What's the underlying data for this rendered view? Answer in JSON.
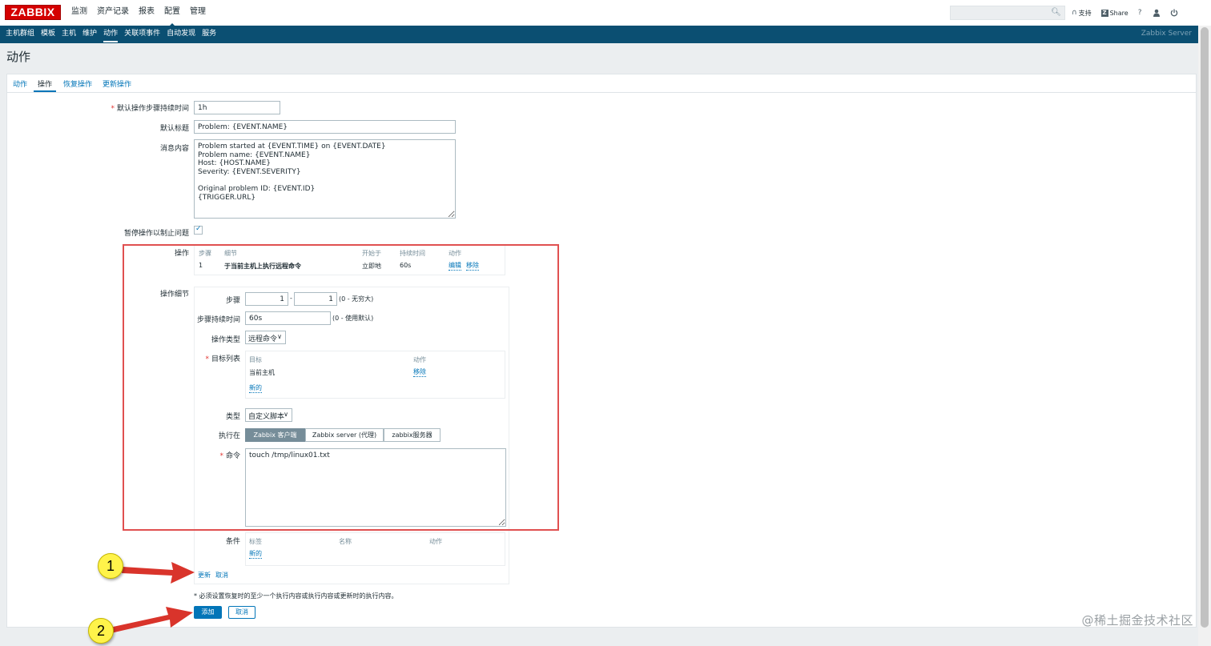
{
  "header": {
    "logo": "ZABBIX",
    "menu": [
      "监测",
      "资产记录",
      "报表",
      "配置",
      "管理"
    ],
    "support": "支持",
    "share": "Share",
    "help": "?",
    "icons": [
      "search-icon",
      "headset-icon",
      "help-icon",
      "user-icon",
      "power-icon"
    ]
  },
  "subnav": {
    "items": [
      "主机群组",
      "模板",
      "主机",
      "维护",
      "动作",
      "关联项事件",
      "自动发现",
      "服务"
    ],
    "server_name": "Zabbix Server"
  },
  "page": {
    "title": "动作"
  },
  "tabs": [
    "动作",
    "操作",
    "恢复操作",
    "更新操作"
  ],
  "form": {
    "step_duration_label": "默认操作步骤持续时间",
    "step_duration_value": "1h",
    "default_subject_label": "默认标题",
    "default_subject_value": "Problem: {EVENT.NAME}",
    "message_label": "消息内容",
    "message_value": "Problem started at {EVENT.TIME} on {EVENT.DATE}\nProblem name: {EVENT.NAME}\nHost: {HOST.NAME}\nSeverity: {EVENT.SEVERITY}\n\nOriginal problem ID: {EVENT.ID}\n{TRIGGER.URL}",
    "pause_label": "暂停操作以制止问题",
    "pause_checked": true
  },
  "operations": {
    "label": "操作",
    "headers": [
      "步骤",
      "细节",
      "开始于",
      "持续时间",
      "动作"
    ],
    "rows": [
      {
        "step": "1",
        "detail": "于当前主机上执行远程命令",
        "start": "立即地",
        "duration": "60s",
        "edit": "编辑",
        "remove": "移除"
      }
    ]
  },
  "details": {
    "label": "操作细节",
    "steps_label": "步骤",
    "step_from": "1",
    "step_dash": "-",
    "step_to": "1",
    "step_hint": "(0 - 无穷大)",
    "duration_label": "步骤持续时间",
    "duration_value": "60s",
    "duration_hint": "(0 - 使用默认)",
    "optype_label": "操作类型",
    "optype_value": "远程命令",
    "targets_label": "目标列表",
    "targets_headers": [
      "目标",
      "动作"
    ],
    "target_row": {
      "name": "当前主机",
      "remove": "移除"
    },
    "targets_new": "新的",
    "type_label": "类型",
    "type_value": "自定义脚本",
    "execute_label": "执行在",
    "execute_options": [
      "Zabbix 客户端",
      "Zabbix server (代理)",
      "zabbix服务器"
    ],
    "command_label": "命令",
    "command_value": "touch /tmp/linux01.txt",
    "conditions_label": "条件",
    "conditions_headers": [
      "标签",
      "名称",
      "动作"
    ],
    "conditions_new": "新的",
    "update_link": "更新",
    "cancel_link": "取消"
  },
  "footer": {
    "note": "* 必须设置恢复时的至少一个执行内容或执行内容或更新时的执行内容。",
    "add_button": "添加",
    "cancel_button": "取消"
  },
  "annotations": {
    "callout1": "1",
    "callout2": "2",
    "highlight_color": "#e05050",
    "arrow_color": "#d9342b"
  },
  "watermark": "@稀土掘金技术社区",
  "colors": {
    "logo_red": "#d40000",
    "subnav_blue": "#0b4f72",
    "link_blue": "#0275b8"
  }
}
